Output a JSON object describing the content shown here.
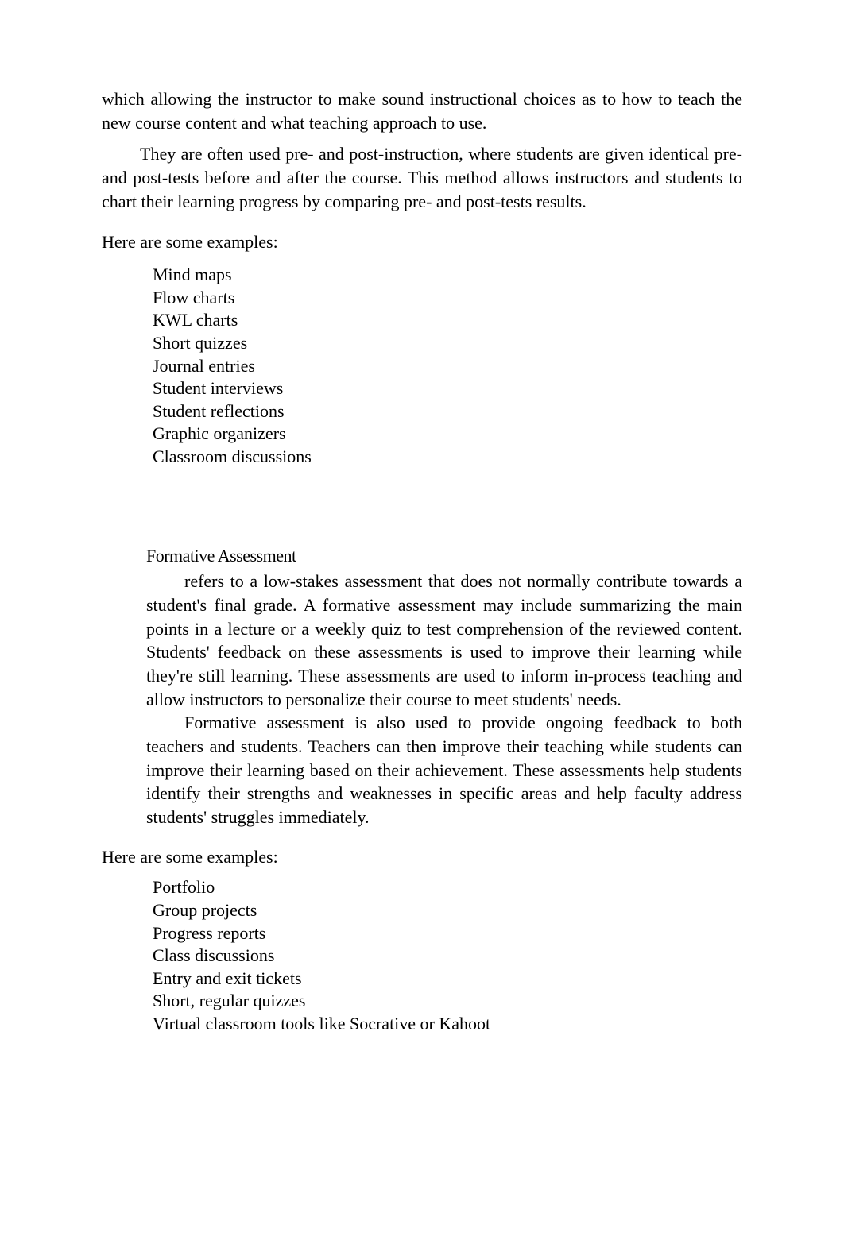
{
  "para1": "which allowing the instructor to make sound instructional choices as to how to teach the new course content and what teaching approach to use.",
  "para2": "They are often used pre- and post-instruction, where students are given identical pre- and post-tests before and after the course. This method allows instructors and students to chart their learning progress by comparing pre- and post-tests results.",
  "examplesIntro": "Here are some examples:",
  "list1": [
    "Mind maps",
    "Flow charts",
    "KWL charts",
    "Short quizzes",
    "Journal entries",
    "Student interviews",
    "Student reflections",
    "Graphic organizers",
    "Classroom discussions"
  ],
  "section": {
    "heading": "Formative Assessment",
    "para1": "refers to a low-stakes assessment that does not normally contribute towards a student's final grade. A formative assessment may include summarizing the main points in a lecture or a weekly quiz to test comprehension of the reviewed content. Students' feedback on these assessments is used to improve their learning while they're still learning. These assessments are used to inform in-process teaching and allow instructors to personalize their course to meet students' needs.",
    "para2": "Formative assessment is also used to provide ongoing feedback to both teachers and students. Teachers can then improve their teaching while students can improve their learning based on their achievement. These assessments help students identify their strengths and weaknesses in specific areas and help faculty address students' struggles immediately."
  },
  "examplesIntro2": "Here are some examples:",
  "list2": [
    "Portfolio",
    "Group projects",
    "Progress reports",
    "Class discussions",
    "Entry and exit tickets",
    "Short, regular quizzes",
    "Virtual classroom tools like Socrative or Kahoot"
  ],
  "bulletMarker": ""
}
